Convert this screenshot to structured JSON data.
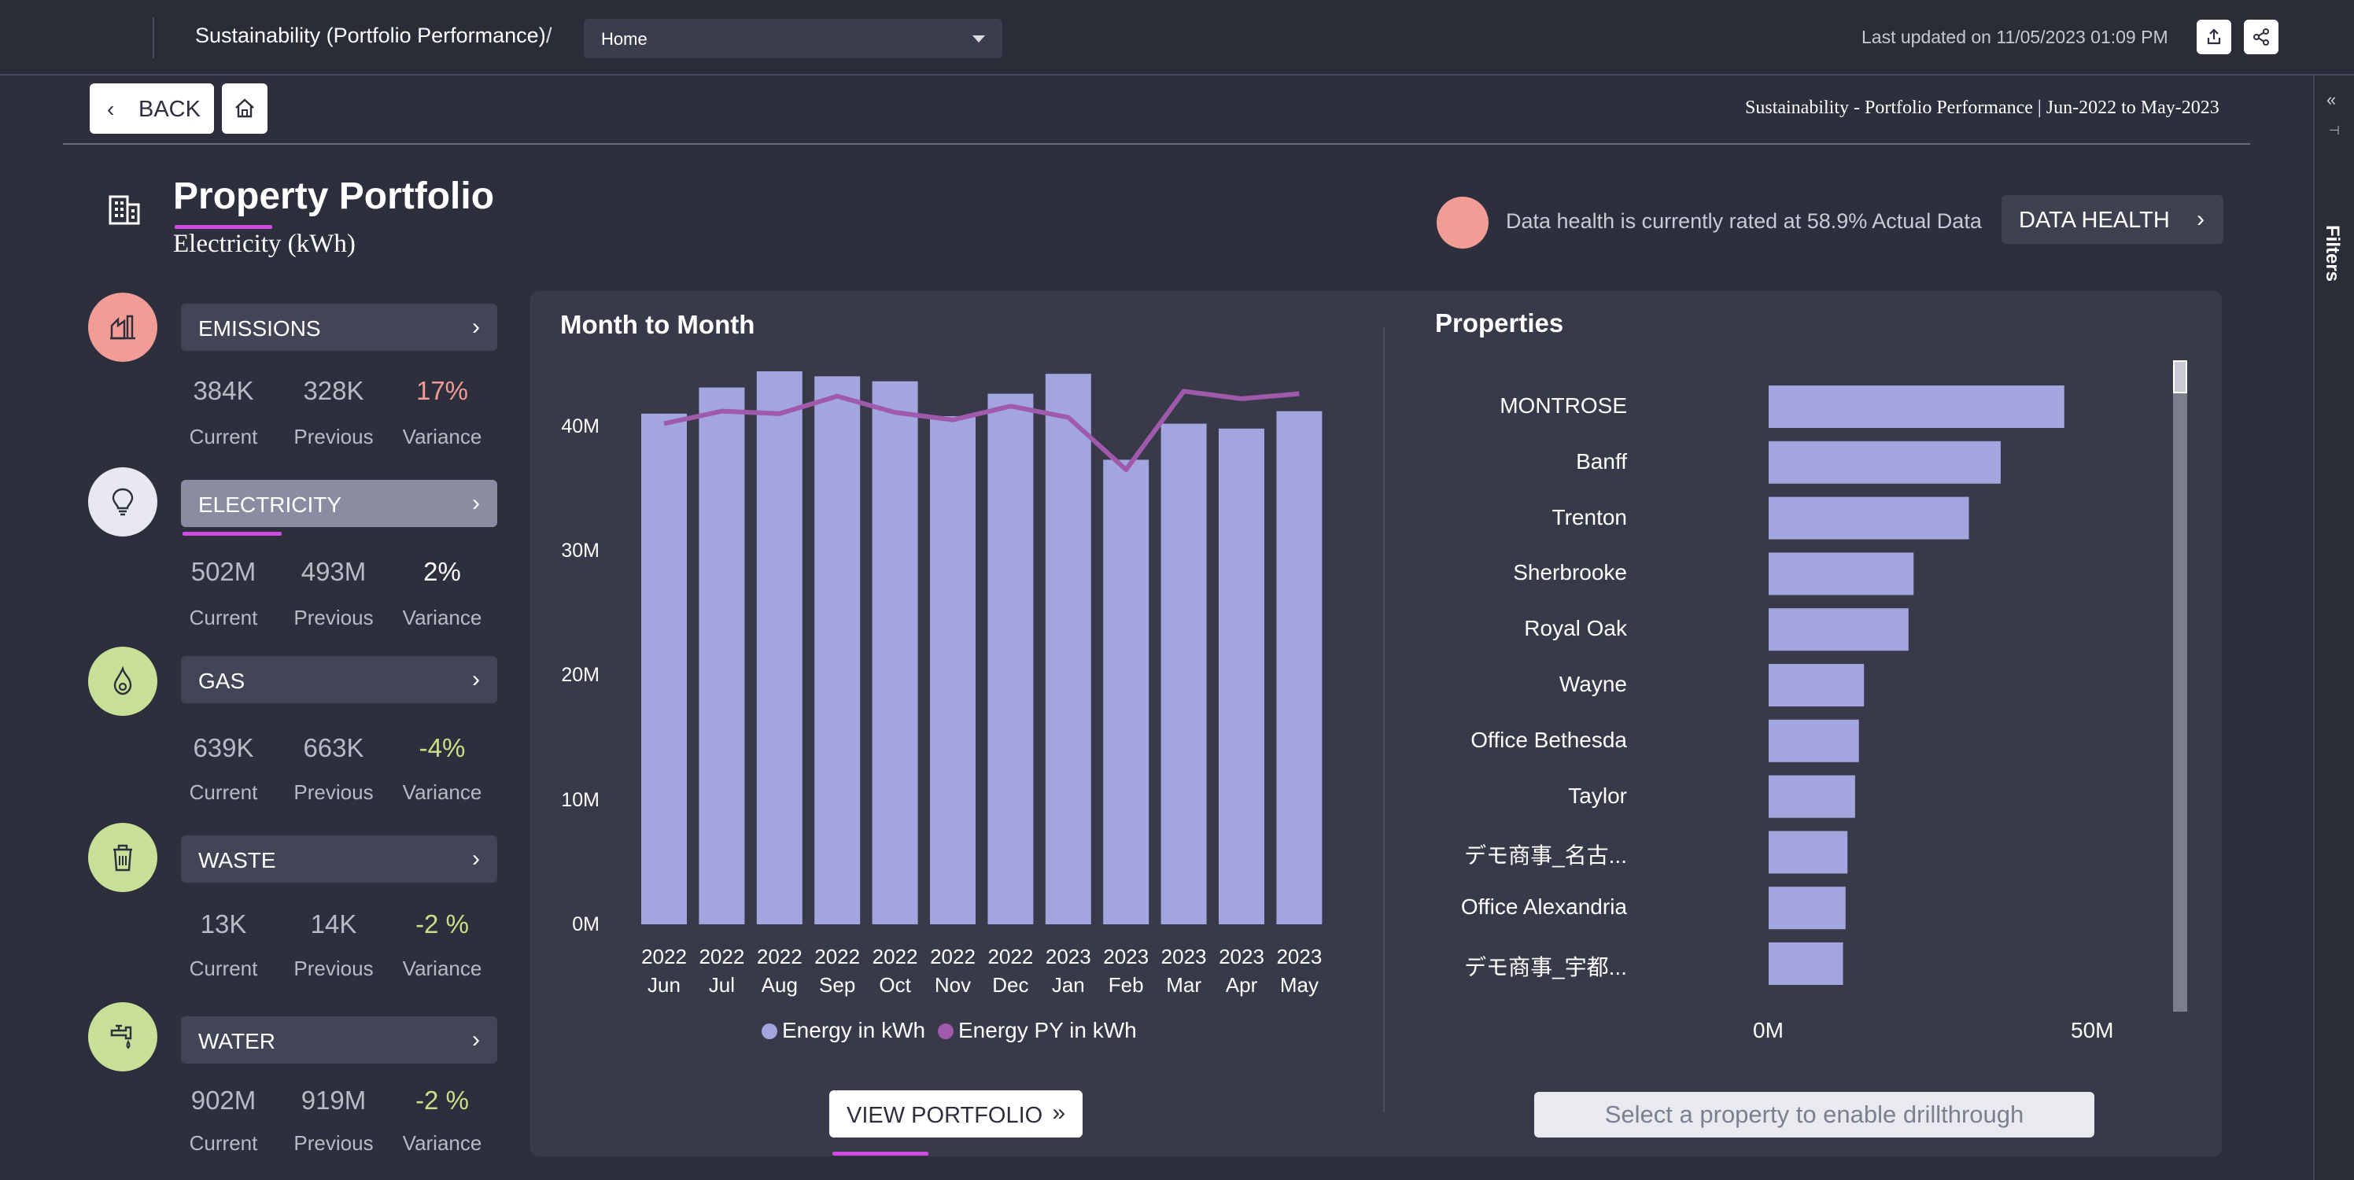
{
  "topbar": {
    "breadcrumb": "Sustainability (Portfolio Performance)",
    "separator": "/",
    "page_select": "Home",
    "last_updated": "Last updated on 11/05/2023 01:09 PM"
  },
  "filters": {
    "label": "Filters"
  },
  "header": {
    "back_label": "BACK",
    "report_title": "Sustainability - Portfolio Performance | Jun-2022 to May-2023"
  },
  "portfolio": {
    "title": "Property Portfolio",
    "subtitle": "Electricity (kWh)",
    "health_text": "Data health is currently rated at 58.9% Actual Data",
    "health_button": "DATA HEALTH",
    "health_color": "#f19c94"
  },
  "kpis": [
    {
      "label": "EMISSIONS",
      "current": "384K",
      "previous": "328K",
      "variance": "17%",
      "variance_color": "#f19c94",
      "icon": "factory-icon",
      "circle_color": "#f19c94",
      "active": false
    },
    {
      "label": "ELECTRICITY",
      "current": "502M",
      "previous": "493M",
      "variance": "2%",
      "variance_color": "#ffffff",
      "icon": "lightbulb-icon",
      "circle_color": "#e8e9f0",
      "active": true
    },
    {
      "label": "GAS",
      "current": "639K",
      "previous": "663K",
      "variance": "-4%",
      "variance_color": "#c8e08a",
      "icon": "flame-icon",
      "circle_color": "#c7df97",
      "active": false
    },
    {
      "label": "WASTE",
      "current": "13K",
      "previous": "14K",
      "variance": "-2 %",
      "variance_color": "#c8e08a",
      "icon": "recycle-bin-icon",
      "circle_color": "#c7df97",
      "active": false
    },
    {
      "label": "WATER",
      "current": "902M",
      "previous": "919M",
      "variance": "-2 %",
      "variance_color": "#c8e08a",
      "icon": "water-tap-icon",
      "circle_color": "#c7df97",
      "active": false
    }
  ],
  "kpi_labels": {
    "current": "Current",
    "previous": "Previous",
    "variance": "Variance"
  },
  "chart_titles": {
    "month_to_month": "Month to Month",
    "properties": "Properties"
  },
  "buttons": {
    "view_portfolio": "VIEW PORTFOLIO",
    "drillthrough": "Select a property to enable drillthrough"
  },
  "chart_data": [
    {
      "type": "bar",
      "title": "Month to Month",
      "categories": [
        "2022 Jun",
        "2022 Jul",
        "2022 Aug",
        "2022 Sep",
        "2022 Oct",
        "2022 Nov",
        "2022 Dec",
        "2023 Jan",
        "2023 Feb",
        "2023 Mar",
        "2023 Apr",
        "2023 May"
      ],
      "series": [
        {
          "name": "Energy in kWh",
          "type": "bar",
          "color": "#a3a5df",
          "values": [
            41.0,
            43.1,
            44.4,
            44.0,
            43.6,
            40.8,
            42.6,
            44.2,
            37.3,
            40.2,
            39.8,
            41.2
          ]
        },
        {
          "name": "Energy PY in kWh",
          "type": "line",
          "color": "#a05aac",
          "values": [
            40.2,
            41.2,
            41.0,
            42.4,
            41.1,
            40.5,
            41.6,
            40.7,
            36.5,
            42.8,
            42.2,
            42.6
          ]
        }
      ],
      "yticks": [
        "0M",
        "10M",
        "20M",
        "30M",
        "40M"
      ],
      "ylim": [
        0,
        44.4
      ],
      "unit": "M"
    },
    {
      "type": "bar",
      "orientation": "horizontal",
      "title": "Properties",
      "categories": [
        "MONTROSE",
        "Banff",
        "Trenton",
        "Sherbrooke",
        "Royal Oak",
        "Wayne",
        "Office Bethesda",
        "Taylor",
        "デモ商事_名古...",
        "Office Alexandria",
        "デモ商事_宇都..."
      ],
      "values": [
        46.5,
        36.5,
        31.5,
        22.8,
        22.0,
        15.0,
        14.2,
        13.6,
        12.4,
        12.1,
        11.7
      ],
      "color": "#a3a5df",
      "xticks": [
        "0M",
        "50M"
      ],
      "xlim": [
        0,
        50
      ],
      "unit": "M"
    }
  ]
}
